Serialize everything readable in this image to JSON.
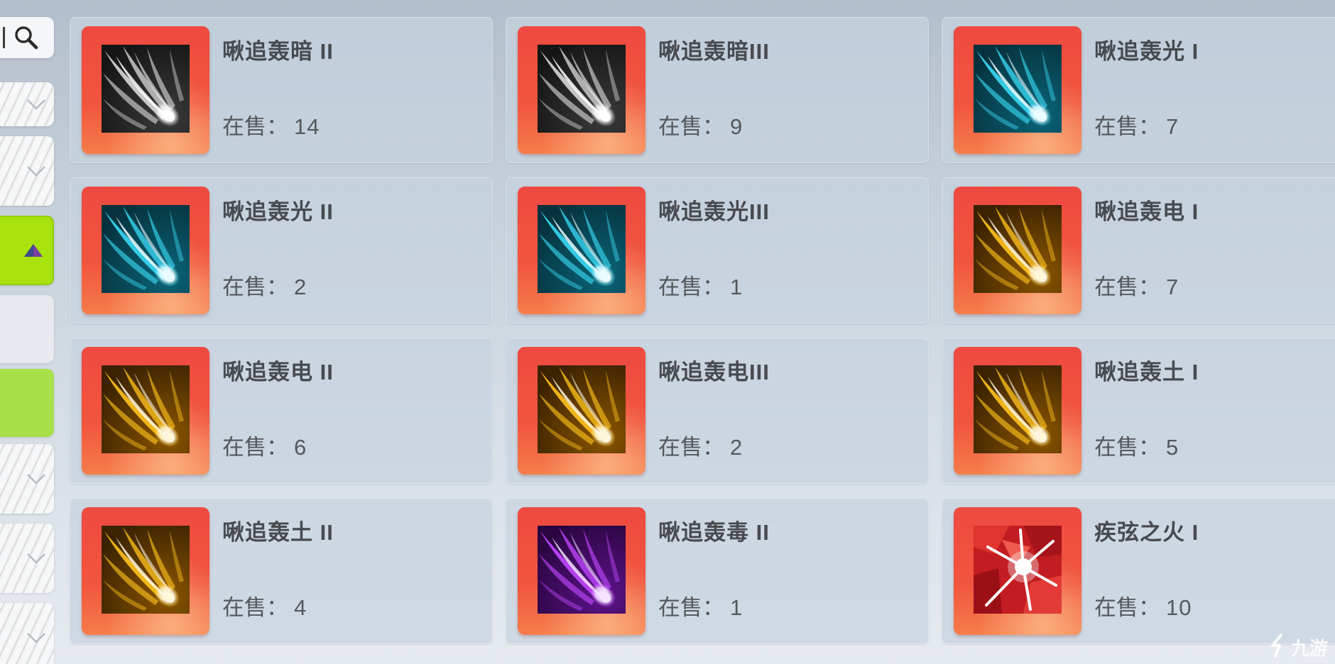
{
  "sidebar": {
    "search_icon": "search-icon",
    "tabs": [
      {
        "style": "white",
        "icon": "chevron-down-icon"
      },
      {
        "style": "white",
        "icon": "chevron-down-icon"
      },
      {
        "style": "active",
        "icon": "triangle-up-icon",
        "color": "#a9e30d"
      },
      {
        "style": "blank",
        "icon": ""
      },
      {
        "style": "lime",
        "icon": "",
        "color": "#a6e04a"
      },
      {
        "style": "white",
        "icon": "chevron-down-icon"
      },
      {
        "style": "white",
        "icon": "chevron-down-icon"
      },
      {
        "style": "white",
        "icon": "chevron-down-icon"
      }
    ]
  },
  "stock_label": "在售：",
  "items": [
    {
      "name": "啾追轰暗 II",
      "stock": "14",
      "icon": "dark",
      "icon_color": "#8a8a8a"
    },
    {
      "name": "啾追轰暗III",
      "stock": "9",
      "icon": "dark",
      "icon_color": "#8a8a8a"
    },
    {
      "name": "啾追轰光 I",
      "stock": "7",
      "icon": "light",
      "icon_color": "#27c6e6"
    },
    {
      "name": "啾追轰光 II",
      "stock": "2",
      "icon": "light",
      "icon_color": "#27c6e6"
    },
    {
      "name": "啾追轰光III",
      "stock": "1",
      "icon": "light",
      "icon_color": "#27c6e6"
    },
    {
      "name": "啾追轰电 I",
      "stock": "7",
      "icon": "thunder",
      "icon_color": "#f3b21b"
    },
    {
      "name": "啾追轰电 II",
      "stock": "6",
      "icon": "thunder",
      "icon_color": "#f3b21b"
    },
    {
      "name": "啾追轰电III",
      "stock": "2",
      "icon": "thunder",
      "icon_color": "#f3b21b"
    },
    {
      "name": "啾追轰土 I",
      "stock": "5",
      "icon": "earth",
      "icon_color": "#f3b21b"
    },
    {
      "name": "啾追轰土 II",
      "stock": "4",
      "icon": "earth",
      "icon_color": "#f3b21b"
    },
    {
      "name": "啾追轰毒 II",
      "stock": "1",
      "icon": "poison",
      "icon_color": "#a32ee0"
    },
    {
      "name": "疾弦之火 I",
      "stock": "10",
      "icon": "fire",
      "icon_color": "#d9242a"
    }
  ],
  "watermark": {
    "text": "九游"
  }
}
